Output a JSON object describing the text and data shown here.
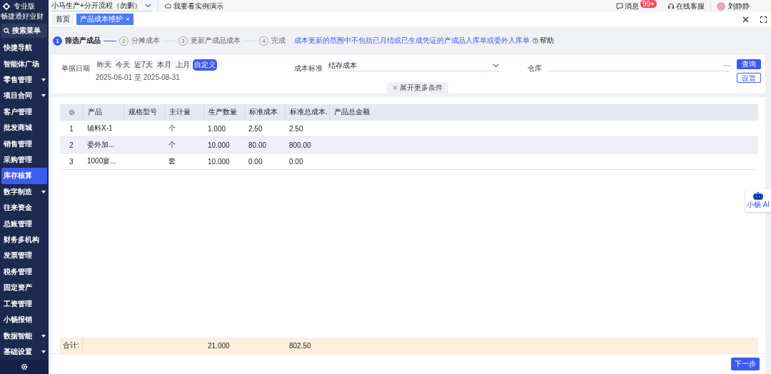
{
  "sidebar": {
    "logo_text": "畅捷通好业财",
    "edition": "专业版",
    "search": "搜索菜单",
    "items": [
      {
        "label": "快捷导航",
        "selected": false,
        "has_submenu": false
      },
      {
        "label": "智能体广场",
        "selected": false,
        "has_submenu": false
      },
      {
        "label": "零售管理",
        "selected": false,
        "has_submenu": true
      },
      {
        "label": "项目合同",
        "selected": false,
        "has_submenu": true
      },
      {
        "label": "客户管理",
        "selected": false,
        "has_submenu": false
      },
      {
        "label": "批发商城",
        "selected": false,
        "has_submenu": false
      },
      {
        "label": "销售管理",
        "selected": false,
        "has_submenu": false
      },
      {
        "label": "采购管理",
        "selected": false,
        "has_submenu": false
      },
      {
        "label": "库存核算",
        "selected": true,
        "has_submenu": false
      },
      {
        "label": "数字制造",
        "selected": false,
        "has_submenu": true
      },
      {
        "label": "往来资金",
        "selected": false,
        "has_submenu": false
      },
      {
        "label": "总账管理",
        "selected": false,
        "has_submenu": false
      },
      {
        "label": "财务多机构",
        "selected": false,
        "has_submenu": false
      },
      {
        "label": "发票管理",
        "selected": false,
        "has_submenu": false
      },
      {
        "label": "税务管理",
        "selected": false,
        "has_submenu": false
      },
      {
        "label": "固定资产",
        "selected": false,
        "has_submenu": false
      },
      {
        "label": "工资管理",
        "selected": false,
        "has_submenu": false
      },
      {
        "label": "小畅报销",
        "selected": false,
        "has_submenu": false
      },
      {
        "label": "数据智能",
        "selected": false,
        "has_submenu": true
      },
      {
        "label": "基础设置",
        "selected": false,
        "has_submenu": true
      }
    ]
  },
  "top_bar": {
    "account_select": "小马生产+分开流程（勿删）",
    "demo_link": "我要看实例演示",
    "messages": {
      "label": "消息",
      "badge": "99+"
    },
    "support": "在线客服",
    "user": "刘静静"
  },
  "tabs": [
    {
      "label": "首页",
      "selected": false,
      "closable": false
    },
    {
      "label": "产品成本维护",
      "selected": true,
      "closable": true
    }
  ],
  "steps": [
    {
      "number": "1",
      "label": "筛选产成品",
      "selected": true
    },
    {
      "number": "2",
      "label": "分摊成本",
      "selected": false
    },
    {
      "number": "3",
      "label": "更新产成品成本",
      "selected": false
    },
    {
      "number": "4",
      "label": "完成",
      "selected": false
    }
  ],
  "notice": "成本更新的范围中不包括已月结或已生成凭证的产成品入库单或委外入库单",
  "help": "帮助",
  "filter": {
    "date_label": "单据日期",
    "quick_ranges": [
      {
        "label": "昨天",
        "selected": false
      },
      {
        "label": "今天",
        "selected": false
      },
      {
        "label": "近7天",
        "selected": false
      },
      {
        "label": "本月",
        "selected": false
      },
      {
        "label": "上月",
        "selected": false
      },
      {
        "label": "自定义",
        "selected": true
      }
    ],
    "date_range": "2025-06-01 至 2025-08-31",
    "cost_standard": {
      "label": "成本标准",
      "value": "结存成本"
    },
    "warehouse": {
      "label": "仓库"
    },
    "expand": "展开更多条件",
    "query_button": "查询",
    "settings_button": "设置"
  },
  "table": {
    "columns": [
      "产品",
      "规格型号",
      "主计量",
      "生产数量",
      "标准成本",
      "标准总成本.",
      "产品总金额"
    ],
    "rows": [
      {
        "index": "1",
        "cells": [
          "辅料X-1",
          "",
          "个",
          "1.000",
          "2.50",
          "2.50",
          ""
        ]
      },
      {
        "index": "2",
        "cells": [
          "委外加...",
          "",
          "个",
          "10.000",
          "80.00",
          "800.00",
          ""
        ]
      },
      {
        "index": "3",
        "cells": [
          "1000宴...",
          "",
          "套",
          "10.000",
          "0.00",
          "0.00",
          ""
        ]
      }
    ],
    "totals": {
      "label": "合计:",
      "quantity": "21.000",
      "total_cost": "802.50"
    }
  },
  "next_button": "下一步",
  "ai_widget": "小畅 AI"
}
